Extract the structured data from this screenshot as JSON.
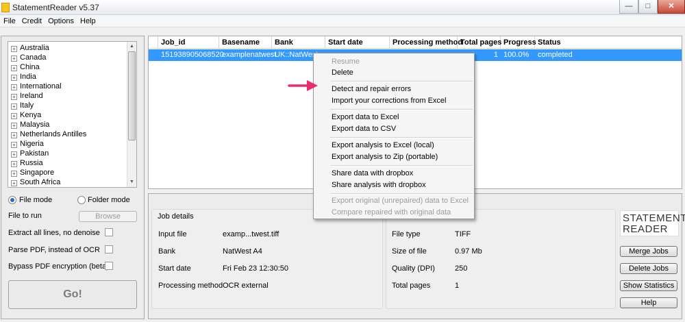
{
  "window": {
    "title": "StatementReader v5.37",
    "min_glyph": "—",
    "max_glyph": "□",
    "close_glyph": "✕"
  },
  "menubar": [
    "File",
    "Credit",
    "Options",
    "Help"
  ],
  "countries": [
    "Australia",
    "Canada",
    "China",
    "India",
    "International",
    "Ireland",
    "Italy",
    "Kenya",
    "Malaysia",
    "Netherlands Antilles",
    "Nigeria",
    "Pakistan",
    "Russia",
    "Singapore",
    "South Africa"
  ],
  "tree_glyphs": {
    "expand": "+",
    "up": "▲",
    "down": "▼"
  },
  "mode": {
    "file_label": "File mode",
    "folder_label": "Folder mode",
    "selected": "file"
  },
  "file_to_run": {
    "label": "File to run",
    "browse_label": "Browse"
  },
  "options": [
    {
      "label": "Extract all lines, no denoise",
      "checked": false
    },
    {
      "label": "Parse PDF, instead of OCR",
      "checked": false
    },
    {
      "label": "Bypass PDF encryption (beta)",
      "checked": false
    }
  ],
  "go_label": "Go!",
  "jobs_table": {
    "columns": [
      "Job_id",
      "Basename",
      "Bank",
      "Start date",
      "Processing method",
      "Total pages",
      "Progress",
      "Status"
    ],
    "rows": [
      {
        "job_id": "151938905068520",
        "basename": "examplenatwest",
        "bank": "UK::NatWest",
        "start_date": "",
        "processing_method": "",
        "total_pages": "1",
        "progress": "100.0%",
        "status": "completed"
      }
    ]
  },
  "job_details": {
    "title": "Job details",
    "left": [
      {
        "label": "Input file",
        "value": "examp...twest.tiff"
      },
      {
        "label": "Bank",
        "value": "NatWest A4"
      },
      {
        "label": "Start date",
        "value": "Fri Feb 23 12:30:50"
      },
      {
        "label": "Processing method",
        "value": "OCR external"
      }
    ],
    "right": [
      {
        "label": "File type",
        "value": "TIFF"
      },
      {
        "label": "Size of file",
        "value": "0.97 Mb"
      },
      {
        "label": "Quality (DPI)",
        "value": "250"
      },
      {
        "label": "Total pages",
        "value": "1"
      }
    ]
  },
  "logo": {
    "line1": "STATEMENT",
    "line2": "READER"
  },
  "side_buttons": [
    "Merge Jobs",
    "Delete Jobs",
    "Show Statistics",
    "Help"
  ],
  "context_menu": {
    "groups": [
      [
        {
          "label": "Resume",
          "enabled": false
        },
        {
          "label": "Delete",
          "enabled": true
        }
      ],
      [
        {
          "label": "Detect and repair errors",
          "enabled": true
        },
        {
          "label": "Import your corrections from Excel",
          "enabled": true
        }
      ],
      [
        {
          "label": "Export data to Excel",
          "enabled": true
        },
        {
          "label": "Export data to CSV",
          "enabled": true
        }
      ],
      [
        {
          "label": "Export analysis to Excel (local)",
          "enabled": true
        },
        {
          "label": "Export analysis to Zip (portable)",
          "enabled": true
        }
      ],
      [
        {
          "label": "Share data with dropbox",
          "enabled": true
        },
        {
          "label": "Share analysis with dropbox",
          "enabled": true
        }
      ],
      [
        {
          "label": "Export original (unrepaired) data to Excel",
          "enabled": false
        },
        {
          "label": "Compare repaired with original data",
          "enabled": false
        }
      ]
    ]
  },
  "colors": {
    "selection": "#3399ff",
    "pointer_arrow": "#ee2a6b"
  }
}
